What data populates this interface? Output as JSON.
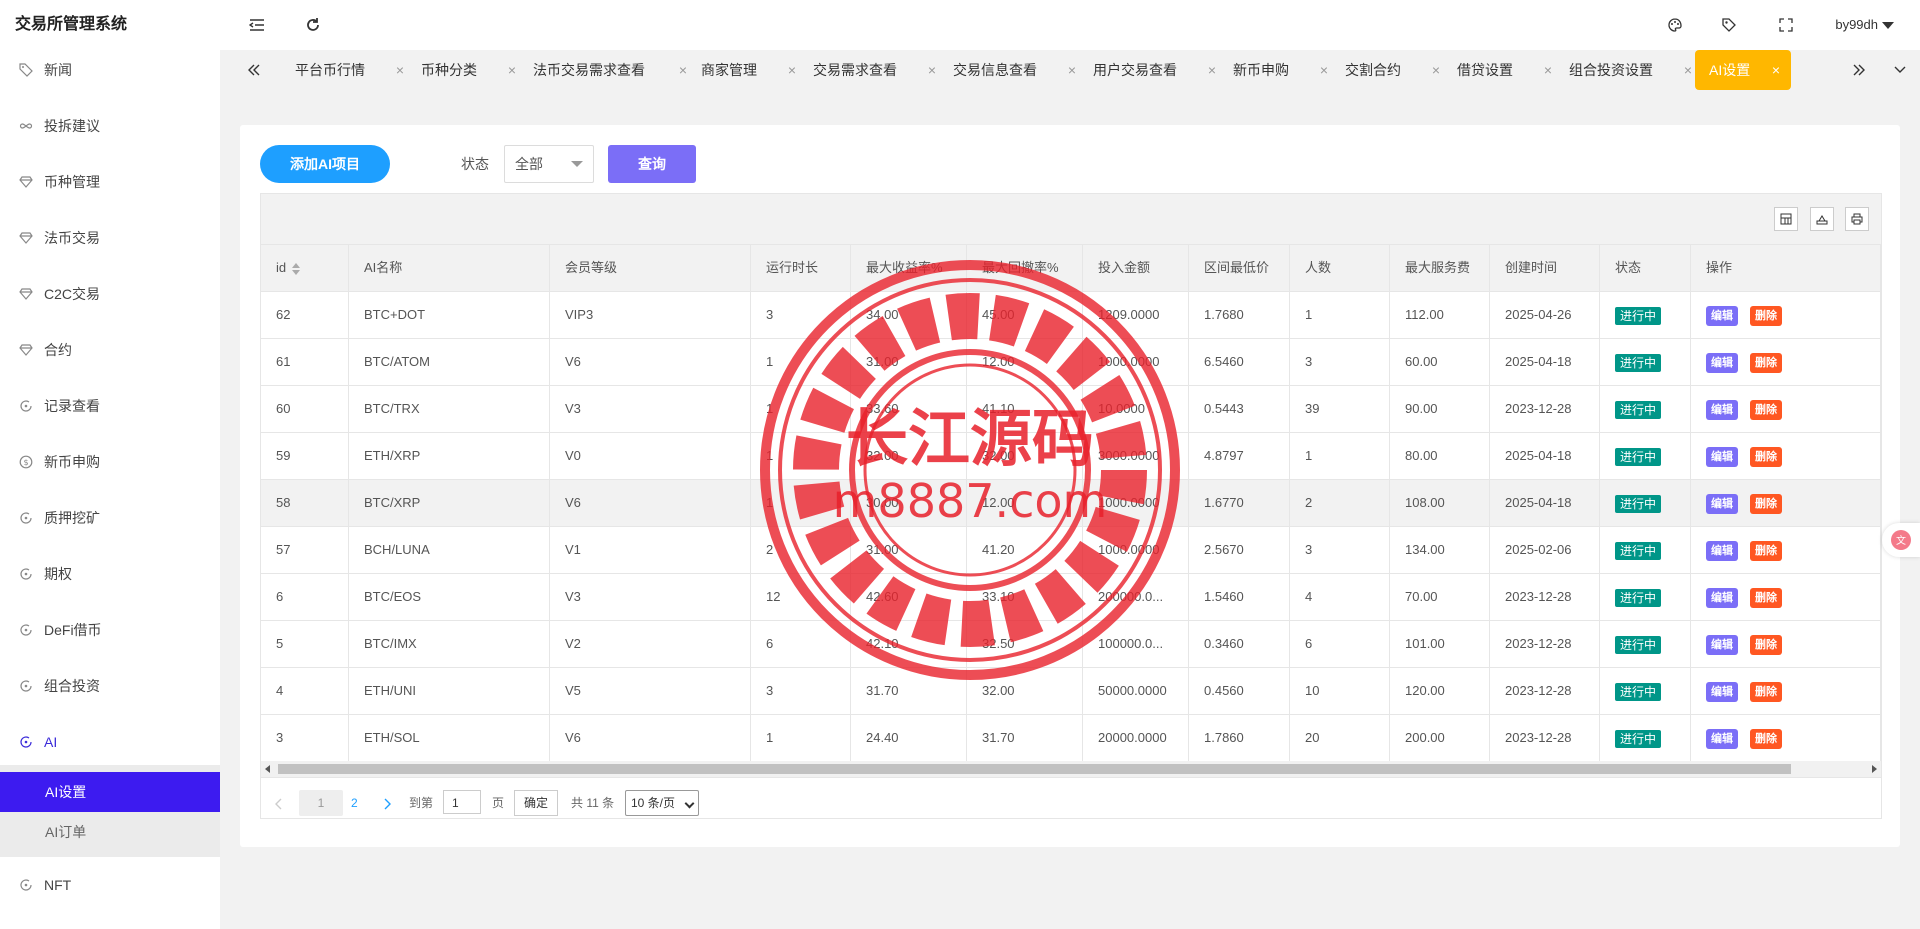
{
  "app": {
    "title": "交易所管理系统",
    "user": "by99dh"
  },
  "sidebar": {
    "items": [
      {
        "label": "新闻",
        "icon": "tag-icon"
      },
      {
        "label": "投拆建议",
        "icon": "infinity-icon"
      },
      {
        "label": "币种管理",
        "icon": "diamond-icon"
      },
      {
        "label": "法币交易",
        "icon": "diamond-icon"
      },
      {
        "label": "C2C交易",
        "icon": "diamond-icon"
      },
      {
        "label": "合约",
        "icon": "diamond-icon"
      },
      {
        "label": "记录查看",
        "icon": "circle-icon"
      },
      {
        "label": "新币申购",
        "icon": "dollar-circle-icon"
      },
      {
        "label": "质押挖矿",
        "icon": "circle-icon"
      },
      {
        "label": "期权",
        "icon": "circle-icon"
      },
      {
        "label": "DeFi借币",
        "icon": "circle-icon"
      },
      {
        "label": "组合投资",
        "icon": "circle-icon"
      },
      {
        "label": "AI",
        "icon": "circle-icon"
      }
    ],
    "sub_items": [
      {
        "label": "AI设置"
      },
      {
        "label": "AI订单"
      }
    ],
    "last_item": {
      "label": "NFT",
      "icon": "circle-icon"
    }
  },
  "tabs": [
    "平台币行情",
    "币种分类",
    "法币交易需求查看",
    "商家管理",
    "交易需求查看",
    "交易信息查看",
    "用户交易查看",
    "新币申购",
    "交割合约",
    "借贷设置",
    "组合投资设置",
    "AI设置"
  ],
  "toolbar": {
    "add_label": "添加AI项目",
    "status_label": "状态",
    "status_value": "全部",
    "query_label": "查询"
  },
  "table": {
    "columns": [
      "id",
      "AI名称",
      "会员等级",
      "运行时长",
      "最大收益率%",
      "最大回撤率%",
      "投入金额",
      "区间最低价",
      "人数",
      "最大服务费",
      "创建时间",
      "状态",
      "操作"
    ],
    "rows": [
      [
        "62",
        "BTC+DOT",
        "VIP3",
        "3",
        "34.00",
        "45.00",
        "1209.0000",
        "1.7680",
        "1",
        "112.00",
        "2025-04-26",
        "进行中"
      ],
      [
        "61",
        "BTC/ATOM",
        "V6",
        "1",
        "31.00",
        "12.00",
        "1000.0000",
        "6.5460",
        "3",
        "60.00",
        "2025-04-18",
        "进行中"
      ],
      [
        "60",
        "BTC/TRX",
        "V3",
        "1",
        "33.60",
        "41.10",
        "10.0000",
        "0.5443",
        "39",
        "90.00",
        "2023-12-28",
        "进行中"
      ],
      [
        "59",
        "ETH/XRP",
        "V0",
        "1",
        "32.00",
        "32.00",
        "3000.0000",
        "4.8797",
        "1",
        "80.00",
        "2025-04-18",
        "进行中"
      ],
      [
        "58",
        "BTC/XRP",
        "V6",
        "1",
        "30.00",
        "12.00",
        "1000.0000",
        "1.6770",
        "2",
        "108.00",
        "2025-04-18",
        "进行中"
      ],
      [
        "57",
        "BCH/LUNA",
        "V1",
        "2",
        "31.00",
        "41.20",
        "1000.0000",
        "2.5670",
        "3",
        "134.00",
        "2025-02-06",
        "进行中"
      ],
      [
        "6",
        "BTC/EOS",
        "V3",
        "12",
        "42.60",
        "33.10",
        "200000.0...",
        "1.5460",
        "4",
        "70.00",
        "2023-12-28",
        "进行中"
      ],
      [
        "5",
        "BTC/IMX",
        "V2",
        "6",
        "42.10",
        "32.50",
        "100000.0...",
        "0.3460",
        "6",
        "101.00",
        "2023-12-28",
        "进行中"
      ],
      [
        "4",
        "ETH/UNI",
        "V5",
        "3",
        "31.70",
        "32.00",
        "50000.0000",
        "0.4560",
        "10",
        "120.00",
        "2023-12-28",
        "进行中"
      ],
      [
        "3",
        "ETH/SOL",
        "V6",
        "1",
        "24.40",
        "31.70",
        "20000.0000",
        "1.7860",
        "20",
        "200.00",
        "2023-12-28",
        "进行中"
      ]
    ],
    "edit_label": "编辑",
    "delete_label": "删除"
  },
  "pager": {
    "current": "1",
    "next": "2",
    "goto_label": "到第",
    "goto_value": "1",
    "page_unit": "页",
    "confirm_label": "确定",
    "total_label": "共 11 条",
    "page_size": "10 条/页"
  },
  "watermark": {
    "title": "长江源码",
    "url": "m8887.com"
  },
  "colors": {
    "accent": "#3d1bf0",
    "add": "#1e9fff",
    "query": "#7b6ef7",
    "active_tab": "#ffb700",
    "status": "#009688",
    "delete": "#ff5722",
    "watermark": "#e8202a"
  }
}
